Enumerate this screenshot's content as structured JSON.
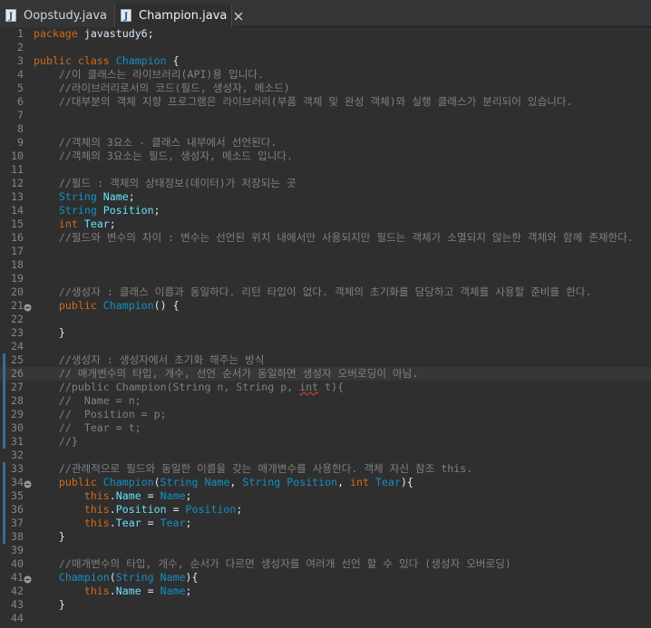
{
  "tabs": [
    {
      "label": "Oopstudy.java",
      "active": false
    },
    {
      "label": "Champion.java",
      "active": true
    }
  ],
  "icons": {
    "file": "java-file-icon",
    "close": "close-icon",
    "fold": "fold-collapse-icon"
  },
  "colors": {
    "keyword": "#cc6c1d",
    "type": "#1290c3",
    "comment": "#808080",
    "field": "#66e1f8",
    "default": "#d9e8f7"
  },
  "lines": [
    {
      "n": "1",
      "tokens": [
        [
          "kw",
          "package"
        ],
        [
          "df",
          " javastudy6;"
        ]
      ]
    },
    {
      "n": "2",
      "tokens": []
    },
    {
      "n": "3",
      "tokens": [
        [
          "kw",
          "public"
        ],
        [
          "df",
          " "
        ],
        [
          "kw",
          "class"
        ],
        [
          "df",
          " "
        ],
        [
          "ty",
          "Champion"
        ],
        [
          "df",
          " {"
        ]
      ]
    },
    {
      "n": "4",
      "tokens": [
        [
          "df",
          "    "
        ],
        [
          "cm",
          "//이 클래스는 라이브러리(API)용 입니다."
        ]
      ]
    },
    {
      "n": "5",
      "tokens": [
        [
          "df",
          "    "
        ],
        [
          "cm",
          "//라이브러리로서의 코드(필드, 생성자, 메소드)"
        ]
      ]
    },
    {
      "n": "6",
      "tokens": [
        [
          "df",
          "    "
        ],
        [
          "cm",
          "//대부분의 객체 지향 프로그램은 라이브러리(부품 객체 및 완성 객체)와 실행 클래스가 분리되어 있습니다."
        ]
      ]
    },
    {
      "n": "7",
      "tokens": []
    },
    {
      "n": "8",
      "tokens": []
    },
    {
      "n": "9",
      "tokens": [
        [
          "df",
          "    "
        ],
        [
          "cm",
          "//객체의 3요소 - 클래스 내부에서 선언된다."
        ]
      ]
    },
    {
      "n": "10",
      "tokens": [
        [
          "df",
          "    "
        ],
        [
          "cm",
          "//객체의 3요소는 필드, 생성자, 메소드 입니다."
        ]
      ]
    },
    {
      "n": "11",
      "tokens": []
    },
    {
      "n": "12",
      "tokens": [
        [
          "df",
          "    "
        ],
        [
          "cm",
          "//필드 : 객체의 상태정보(데이터)가 저장되는 곳"
        ]
      ]
    },
    {
      "n": "13",
      "tokens": [
        [
          "df",
          "    "
        ],
        [
          "ty",
          "String"
        ],
        [
          "df",
          " "
        ],
        [
          "fd",
          "Name"
        ],
        [
          "df",
          ";"
        ]
      ]
    },
    {
      "n": "14",
      "tokens": [
        [
          "df",
          "    "
        ],
        [
          "ty",
          "String"
        ],
        [
          "df",
          " "
        ],
        [
          "fd",
          "Position"
        ],
        [
          "df",
          ";"
        ]
      ]
    },
    {
      "n": "15",
      "tokens": [
        [
          "df",
          "    "
        ],
        [
          "kw",
          "int"
        ],
        [
          "df",
          " "
        ],
        [
          "fd",
          "Tear"
        ],
        [
          "df",
          ";"
        ]
      ]
    },
    {
      "n": "16",
      "tokens": [
        [
          "df",
          "    "
        ],
        [
          "cm",
          "//필드와 변수의 차이 : 변수는 선언된 위치 내에서만 사용되지만 필드는 객체가 소멸되지 않는한 객체와 함께 존재한다."
        ]
      ]
    },
    {
      "n": "17",
      "tokens": []
    },
    {
      "n": "18",
      "tokens": []
    },
    {
      "n": "19",
      "tokens": []
    },
    {
      "n": "20",
      "tokens": [
        [
          "df",
          "    "
        ],
        [
          "cm",
          "//생성자 : 클래스 이름과 동일하다. 리턴 타입이 없다. 객체의 초기화를 담당하고 객체를 사용할 준비를 한다."
        ]
      ]
    },
    {
      "n": "21",
      "fold": true,
      "tokens": [
        [
          "df",
          "    "
        ],
        [
          "kw",
          "public"
        ],
        [
          "df",
          " "
        ],
        [
          "ty",
          "Champion"
        ],
        [
          "df",
          "() {"
        ]
      ]
    },
    {
      "n": "22",
      "tokens": []
    },
    {
      "n": "23",
      "tokens": [
        [
          "df",
          "    }"
        ]
      ]
    },
    {
      "n": "24",
      "tokens": []
    },
    {
      "n": "25",
      "side": true,
      "tokens": [
        [
          "df",
          "    "
        ],
        [
          "cm",
          "//생성자 : 생성자에서 초기화 해주는 방식"
        ]
      ]
    },
    {
      "n": "26",
      "side": true,
      "highlight": true,
      "tokens": [
        [
          "df",
          "    "
        ],
        [
          "cm",
          "// 매개변수의 타입, 개수, 선언 순서가 동일하면 생성자 오버로딩이 아님."
        ]
      ]
    },
    {
      "n": "27",
      "side": true,
      "tokens": [
        [
          "df",
          "    "
        ],
        [
          "cm",
          "//public Champion(String n, String p, "
        ],
        [
          "cmsq",
          "int"
        ],
        [
          "cm",
          " t){"
        ]
      ]
    },
    {
      "n": "28",
      "side": true,
      "tokens": [
        [
          "df",
          "    "
        ],
        [
          "cm",
          "//  Name = n;"
        ]
      ]
    },
    {
      "n": "29",
      "side": true,
      "tokens": [
        [
          "df",
          "    "
        ],
        [
          "cm",
          "//  Position = p;"
        ]
      ]
    },
    {
      "n": "30",
      "side": true,
      "tokens": [
        [
          "df",
          "    "
        ],
        [
          "cm",
          "//  Tear = t;"
        ]
      ]
    },
    {
      "n": "31",
      "side": true,
      "tokens": [
        [
          "df",
          "    "
        ],
        [
          "cm",
          "//}"
        ]
      ]
    },
    {
      "n": "32",
      "tokens": []
    },
    {
      "n": "33",
      "side": true,
      "tokens": [
        [
          "df",
          "    "
        ],
        [
          "cm",
          "//관례적으로 필드와 동일한 이름을 갖는 매개변수를 사용한다. 객체 자신 참조 this."
        ]
      ]
    },
    {
      "n": "34",
      "side": true,
      "fold": true,
      "tokens": [
        [
          "df",
          "    "
        ],
        [
          "kw",
          "public"
        ],
        [
          "df",
          " "
        ],
        [
          "ty",
          "Champion"
        ],
        [
          "df",
          "("
        ],
        [
          "ty",
          "String"
        ],
        [
          "df",
          " "
        ],
        [
          "ty",
          "Name"
        ],
        [
          "df",
          ", "
        ],
        [
          "ty",
          "String"
        ],
        [
          "df",
          " "
        ],
        [
          "ty",
          "Position"
        ],
        [
          "df",
          ", "
        ],
        [
          "kw",
          "int"
        ],
        [
          "df",
          " "
        ],
        [
          "ty",
          "Tear"
        ],
        [
          "df",
          "){"
        ]
      ]
    },
    {
      "n": "35",
      "side": true,
      "tokens": [
        [
          "df",
          "        "
        ],
        [
          "kw",
          "this"
        ],
        [
          "df",
          "."
        ],
        [
          "fd",
          "Name"
        ],
        [
          "df",
          " = "
        ],
        [
          "ty",
          "Name"
        ],
        [
          "df",
          ";"
        ]
      ]
    },
    {
      "n": "36",
      "side": true,
      "tokens": [
        [
          "df",
          "        "
        ],
        [
          "kw",
          "this"
        ],
        [
          "df",
          "."
        ],
        [
          "fd",
          "Position"
        ],
        [
          "df",
          " = "
        ],
        [
          "ty",
          "Position"
        ],
        [
          "df",
          ";"
        ]
      ]
    },
    {
      "n": "37",
      "side": true,
      "tokens": [
        [
          "df",
          "        "
        ],
        [
          "kw",
          "this"
        ],
        [
          "df",
          "."
        ],
        [
          "fd",
          "Tear"
        ],
        [
          "df",
          " = "
        ],
        [
          "ty",
          "Tear"
        ],
        [
          "df",
          ";"
        ]
      ]
    },
    {
      "n": "38",
      "side": true,
      "tokens": [
        [
          "df",
          "    }"
        ]
      ]
    },
    {
      "n": "39",
      "tokens": []
    },
    {
      "n": "40",
      "tokens": [
        [
          "df",
          "    "
        ],
        [
          "cm",
          "//매개변수의 타입, 개수, 순서가 다르면 생성자를 여러개 선언 할 수 있다 (생성자 오버로딩)"
        ]
      ]
    },
    {
      "n": "41",
      "fold": true,
      "tokens": [
        [
          "df",
          "    "
        ],
        [
          "ty",
          "Champion"
        ],
        [
          "df",
          "("
        ],
        [
          "ty",
          "String"
        ],
        [
          "df",
          " "
        ],
        [
          "ty",
          "Name"
        ],
        [
          "df",
          "){"
        ]
      ]
    },
    {
      "n": "42",
      "tokens": [
        [
          "df",
          "        "
        ],
        [
          "kw",
          "this"
        ],
        [
          "df",
          "."
        ],
        [
          "fd",
          "Name"
        ],
        [
          "df",
          " = "
        ],
        [
          "ty",
          "Name"
        ],
        [
          "df",
          ";"
        ]
      ]
    },
    {
      "n": "43",
      "tokens": [
        [
          "df",
          "    }"
        ]
      ]
    },
    {
      "n": "44",
      "tokens": []
    }
  ]
}
